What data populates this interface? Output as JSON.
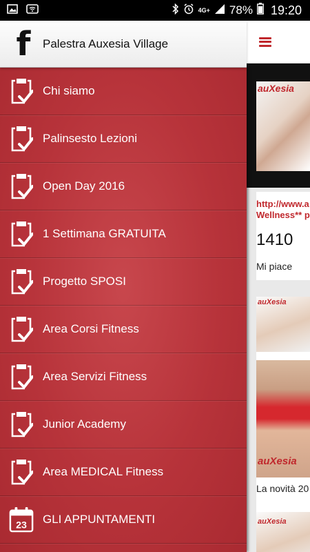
{
  "status_bar": {
    "network": "4G+",
    "battery": "78%",
    "time": "19:20"
  },
  "header": {
    "title": "Palestra Auxesia Village"
  },
  "menu": {
    "items": [
      {
        "label": "Chi siamo",
        "icon": "clipboard-check-icon"
      },
      {
        "label": "Palinsesto Lezioni",
        "icon": "clipboard-check-icon"
      },
      {
        "label": "Open Day 2016",
        "icon": "clipboard-check-icon"
      },
      {
        "label": "1 Settimana GRATUITA",
        "icon": "clipboard-check-icon"
      },
      {
        "label": "Progetto SPOSI",
        "icon": "clipboard-check-icon"
      },
      {
        "label": "Area Corsi Fitness",
        "icon": "clipboard-check-icon"
      },
      {
        "label": "Area Servizi Fitness",
        "icon": "clipboard-check-icon"
      },
      {
        "label": "Junior Academy",
        "icon": "clipboard-check-icon"
      },
      {
        "label": "Area MEDICAL Fitness",
        "icon": "clipboard-check-icon"
      },
      {
        "label": "GLI APPUNTAMENTI",
        "icon": "calendar-icon",
        "day": "23"
      }
    ]
  },
  "background_feed": {
    "brand": "auXesia",
    "post1": {
      "link_text": "http://www.a",
      "link_text_2": "Wellness** p",
      "count": "1410",
      "likes_label": "Mi piace"
    },
    "post2": {
      "text": "La novità 20"
    }
  },
  "colors": {
    "drawer": "#b7333a",
    "accent": "#c0282d",
    "brand_yellow": "#e8a81a"
  }
}
